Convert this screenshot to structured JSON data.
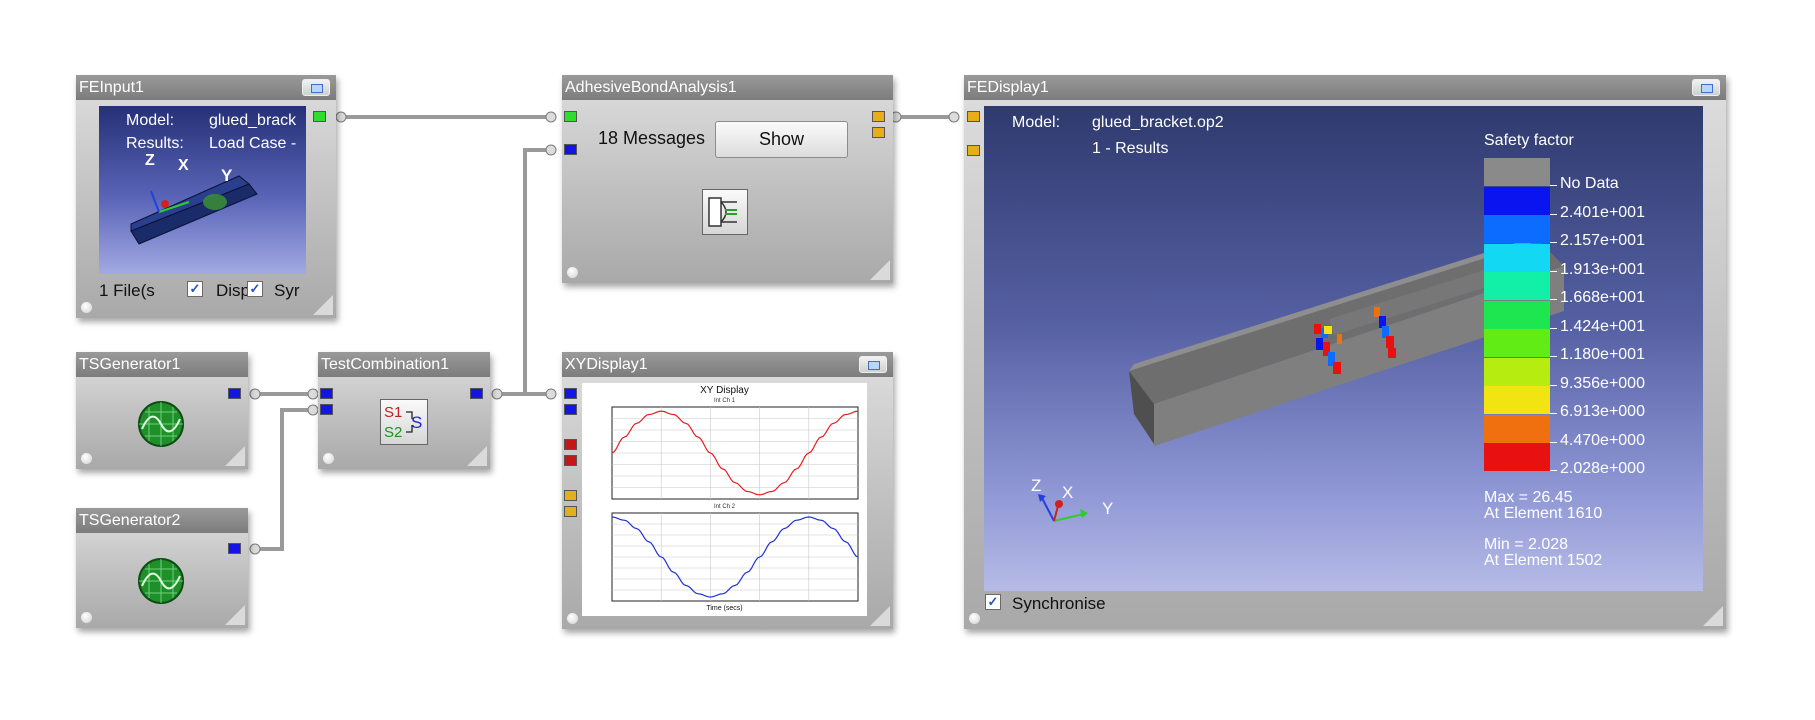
{
  "colors": {
    "port_green": "#2fdc2f",
    "port_blue": "#1414e6",
    "port_orange": "#e7ad1a",
    "port_red": "#c21818",
    "series_1": "#e02020",
    "series_2": "#2030d8"
  },
  "nodes": {
    "feinput": {
      "title": "FEInput1",
      "model_label": "Model:",
      "model_value": "glued_brack",
      "results_label": "Results:",
      "results_value": "Load Case -",
      "files": "1 File(s",
      "display_cb": "Disp",
      "sync_cb": "Syr",
      "axes": {
        "x": "X",
        "y": "Y",
        "z": "Z"
      }
    },
    "adhesive": {
      "title": "AdhesiveBondAnalysis1",
      "messages": "18 Messages",
      "show_button": "Show",
      "icon": "adhesive-bond-icon"
    },
    "fedisplay": {
      "title": "FEDisplay1",
      "model_label": "Model:",
      "model_value": "glued_bracket.op2",
      "results_value": "1 - Results",
      "sync_label": "Synchronise",
      "axes": {
        "x": "X",
        "y": "Y",
        "z": "Z"
      },
      "legend": {
        "title": "Safety factor",
        "entries": [
          {
            "label": "No Data",
            "color": "#8a8a8a"
          },
          {
            "label": "2.401e+001",
            "color": "#0a14f0"
          },
          {
            "label": "2.157e+001",
            "color": "#0c6cff"
          },
          {
            "label": "1.913e+001",
            "color": "#12d8f4"
          },
          {
            "label": "1.668e+001",
            "color": "#12f0a8"
          },
          {
            "label": "1.424e+001",
            "color": "#1ee650"
          },
          {
            "label": "1.180e+001",
            "color": "#60ec14"
          },
          {
            "label": "9.356e+000",
            "color": "#b6ec10"
          },
          {
            "label": "6.913e+000",
            "color": "#f2e410"
          },
          {
            "label": "4.470e+000",
            "color": "#f07010"
          },
          {
            "label": "2.028e+000",
            "color": "#e81010"
          }
        ]
      },
      "max_label": "Max = 26.45",
      "max_elem": "At Element 1610",
      "min_label": "Min = 2.028",
      "min_elem": "At Element 1502"
    },
    "tsgen1": {
      "title": "TSGenerator1",
      "icon": "waveform-generator-icon"
    },
    "tsgen2": {
      "title": "TSGenerator2",
      "icon": "waveform-generator-icon"
    },
    "testcomb": {
      "title": "TestCombination1",
      "s1": "S1",
      "s2": "S2",
      "s": "S"
    },
    "xydisplay": {
      "title": "XYDisplay1",
      "plot_title": "XY Display",
      "chart1_title": "Int Ch 1",
      "chart2_title": "Int Ch 2",
      "x_label": "Time (secs)"
    }
  },
  "chart_data": [
    {
      "type": "line",
      "title": "Int Ch 1",
      "series": [
        {
          "values_note": "sine",
          "color": "#e02020",
          "x": [
            0,
            0.5,
            1,
            1.5,
            2,
            2.5,
            3,
            3.5,
            4,
            4.5,
            5,
            5.5,
            6,
            6.5,
            7,
            7.5,
            8,
            8.5,
            9,
            9.5,
            10
          ],
          "y": [
            0,
            0.38,
            0.71,
            0.92,
            1.0,
            0.92,
            0.71,
            0.38,
            0,
            -0.38,
            -0.71,
            -0.92,
            -1.0,
            -0.92,
            -0.71,
            -0.38,
            0,
            0.38,
            0.71,
            0.92,
            1.0
          ]
        }
      ],
      "ylim": [
        -1.1,
        1.1
      ]
    },
    {
      "type": "line",
      "title": "Int Ch 2",
      "xlabel": "Time (secs)",
      "series": [
        {
          "color": "#2030d8",
          "x": [
            0,
            0.5,
            1,
            1.5,
            2,
            2.5,
            3,
            3.5,
            4,
            4.5,
            5,
            5.5,
            6,
            6.5,
            7,
            7.5,
            8,
            8.5,
            9,
            9.5,
            10
          ],
          "y": [
            1.0,
            0.92,
            0.71,
            0.38,
            0,
            -0.38,
            -0.71,
            -0.92,
            -1.0,
            -0.92,
            -0.71,
            -0.38,
            0,
            0.38,
            0.71,
            0.92,
            1.0,
            0.92,
            0.71,
            0.38,
            0
          ]
        }
      ],
      "ylim": [
        -1.1,
        1.1
      ]
    }
  ]
}
